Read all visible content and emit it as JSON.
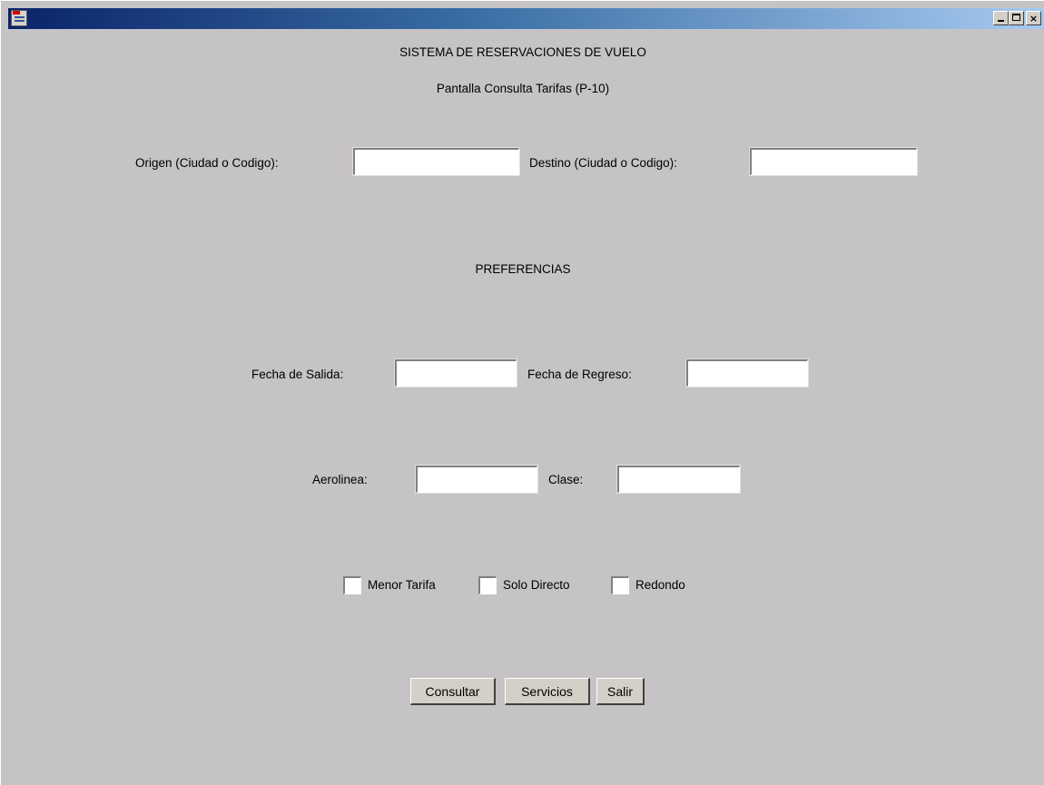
{
  "window": {
    "title": "",
    "controls": {
      "minimize": "minimize-icon",
      "maximize": "maximize-icon",
      "close": "close-icon"
    },
    "close_glyph": "×"
  },
  "header": {
    "system_title": "SISTEMA DE RESERVACIONES DE VUELO",
    "screen_title": "Pantalla Consulta Tarifas (P-10)"
  },
  "route": {
    "origin_label": "Origen (Ciudad o Codigo):",
    "origin_value": "",
    "destination_label": "Destino (Ciudad o Codigo):",
    "destination_value": ""
  },
  "preferences": {
    "heading": "PREFERENCIAS",
    "departure_label": "Fecha de Salida:",
    "departure_value": "",
    "return_label": "Fecha de Regreso:",
    "return_value": "",
    "airline_label": "Aerolinea:",
    "airline_value": "",
    "class_label": "Clase:",
    "class_value": ""
  },
  "options": [
    {
      "label": "Menor Tarifa",
      "checked": false
    },
    {
      "label": "Solo Directo",
      "checked": false
    },
    {
      "label": "Redondo",
      "checked": false
    }
  ],
  "actions": {
    "consultar": "Consultar",
    "servicios": "Servicios",
    "salir": "Salir"
  },
  "colors": {
    "window_bg": "#c6c3c6",
    "titlebar_start": "#0a246a",
    "titlebar_end": "#a6caf0"
  }
}
